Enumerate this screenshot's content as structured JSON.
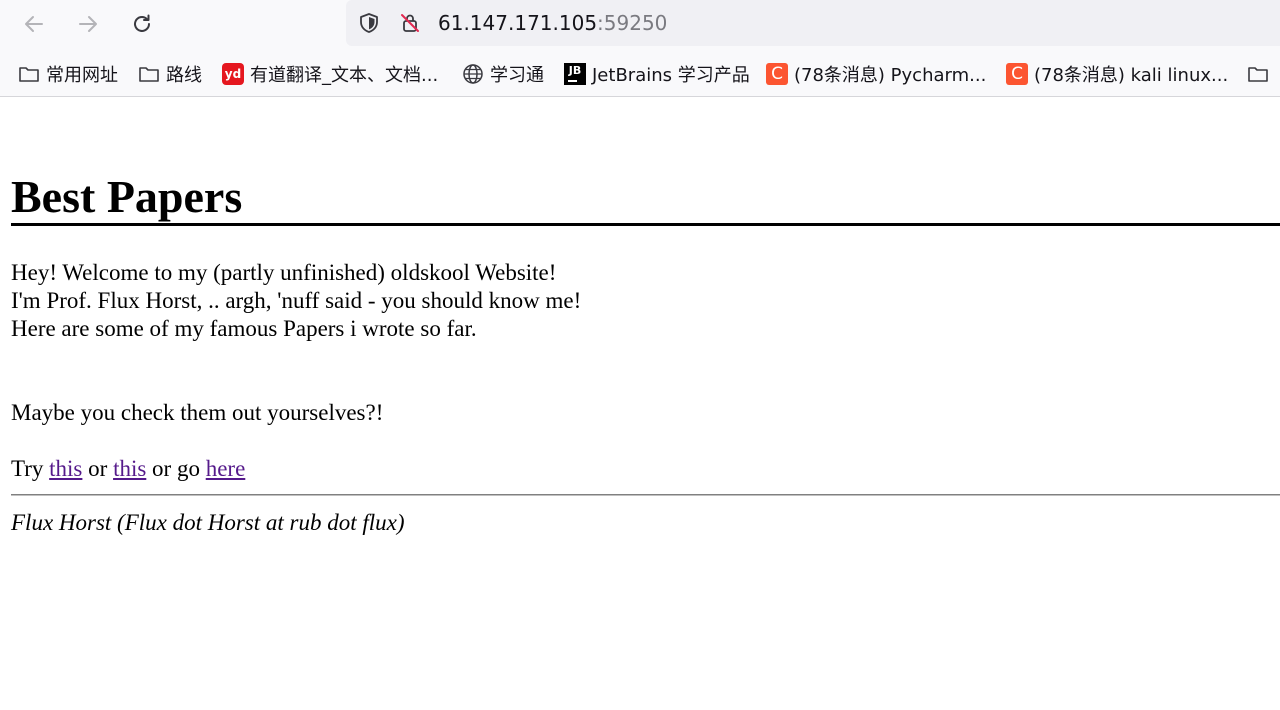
{
  "browser": {
    "url_host": "61.147.171.105",
    "url_port": ":59250",
    "bookmarks": [
      {
        "label": "常用网址",
        "icon": "folder-icon"
      },
      {
        "label": "路线",
        "icon": "folder-icon"
      },
      {
        "label": "有道翻译_文本、文档...",
        "icon": "youdao-icon",
        "icon_text": "yd"
      },
      {
        "label": "学习通",
        "icon": "globe-icon"
      },
      {
        "label": "JetBrains 学习产品",
        "icon": "jetbrains-icon",
        "icon_text": "JB"
      },
      {
        "label": "(78条消息) Pycharm...",
        "icon": "csdn-icon",
        "icon_text": "C"
      },
      {
        "label": "(78条消息) kali linux...",
        "icon": "csdn-icon",
        "icon_text": "C"
      },
      {
        "label": "",
        "icon": "folder-icon"
      }
    ]
  },
  "page": {
    "title": "Best Papers",
    "intro_lines": [
      "Hey! Welcome to my (partly unfinished) oldskool Website!",
      "I'm Prof. Flux Horst, .. argh, 'nuff said - you should know me!",
      "Here are some of my famous Papers i wrote so far."
    ],
    "check_text": "Maybe you check them out yourselves?!",
    "try_prefix": "Try ",
    "link1": "this",
    "or_text": " or ",
    "link2": "this",
    "or_go_text": " or go ",
    "link3": "here",
    "footer": "Flux Horst (Flux dot Horst at rub dot flux)"
  },
  "colors": {
    "visited_link": "#551a8b",
    "urlbar_bg": "#f0f0f4",
    "chrome_bg": "#f9f9fb"
  }
}
